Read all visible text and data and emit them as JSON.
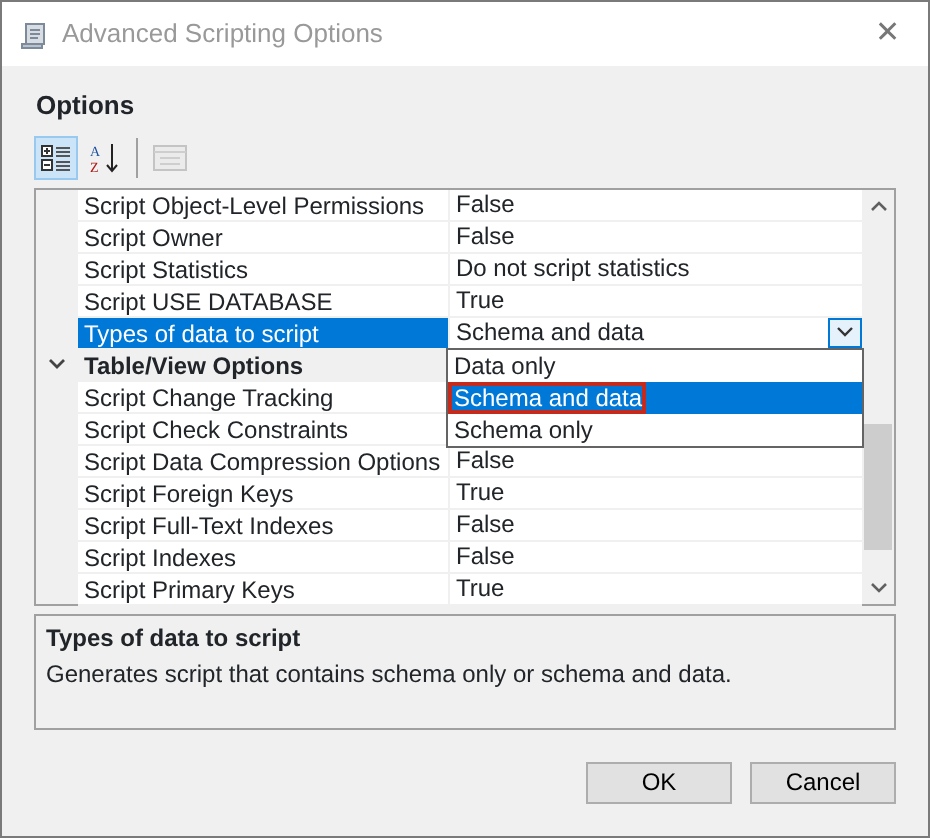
{
  "window": {
    "title": "Advanced Scripting Options",
    "close": "✕"
  },
  "section_title": "Options",
  "toolbar": [
    {
      "kind": "categorized",
      "selected": true,
      "disabled": false
    },
    {
      "kind": "alphabetical",
      "selected": false,
      "disabled": false,
      "letters": [
        "A",
        "Z"
      ]
    },
    {
      "kind": "property-pages",
      "selected": false,
      "disabled": true
    }
  ],
  "grid": {
    "rows": [
      {
        "kind": "property",
        "name": "Script Object-Level Permissions",
        "value": "False",
        "selected": false
      },
      {
        "kind": "property",
        "name": "Script Owner",
        "value": "False",
        "selected": false
      },
      {
        "kind": "property",
        "name": "Script Statistics",
        "value": "Do not script statistics",
        "selected": false
      },
      {
        "kind": "property",
        "name": "Script USE DATABASE",
        "value": "True",
        "selected": false
      },
      {
        "kind": "property",
        "name": "Types of data to script",
        "value": "Schema and data",
        "selected": true
      },
      {
        "kind": "category",
        "name": "Table/View Options",
        "expanded": true,
        "selected": false
      },
      {
        "kind": "property",
        "name": "Script Change Tracking",
        "selected": false
      },
      {
        "kind": "property",
        "name": "Script Check Constraints",
        "selected": false
      },
      {
        "kind": "property",
        "name": "Script Data Compression Options",
        "value": "False",
        "selected": false
      },
      {
        "kind": "property",
        "name": "Script Foreign Keys",
        "value": "True",
        "selected": false
      },
      {
        "kind": "property",
        "name": "Script Full-Text Indexes",
        "value": "False",
        "selected": false
      },
      {
        "kind": "property",
        "name": "Script Indexes",
        "value": "False",
        "selected": false
      },
      {
        "kind": "property",
        "name": "Script Primary Keys",
        "value": "True",
        "selected": false
      }
    ],
    "dropdown": {
      "open": true,
      "options": [
        {
          "label": "Data only",
          "selected": false
        },
        {
          "label": "Schema and data",
          "selected": true
        },
        {
          "label": "Schema only",
          "selected": false
        }
      ]
    }
  },
  "description": {
    "title": "Types of data to script",
    "text": "Generates script that contains schema only or schema and data."
  },
  "buttons": [
    "OK",
    "Cancel"
  ]
}
